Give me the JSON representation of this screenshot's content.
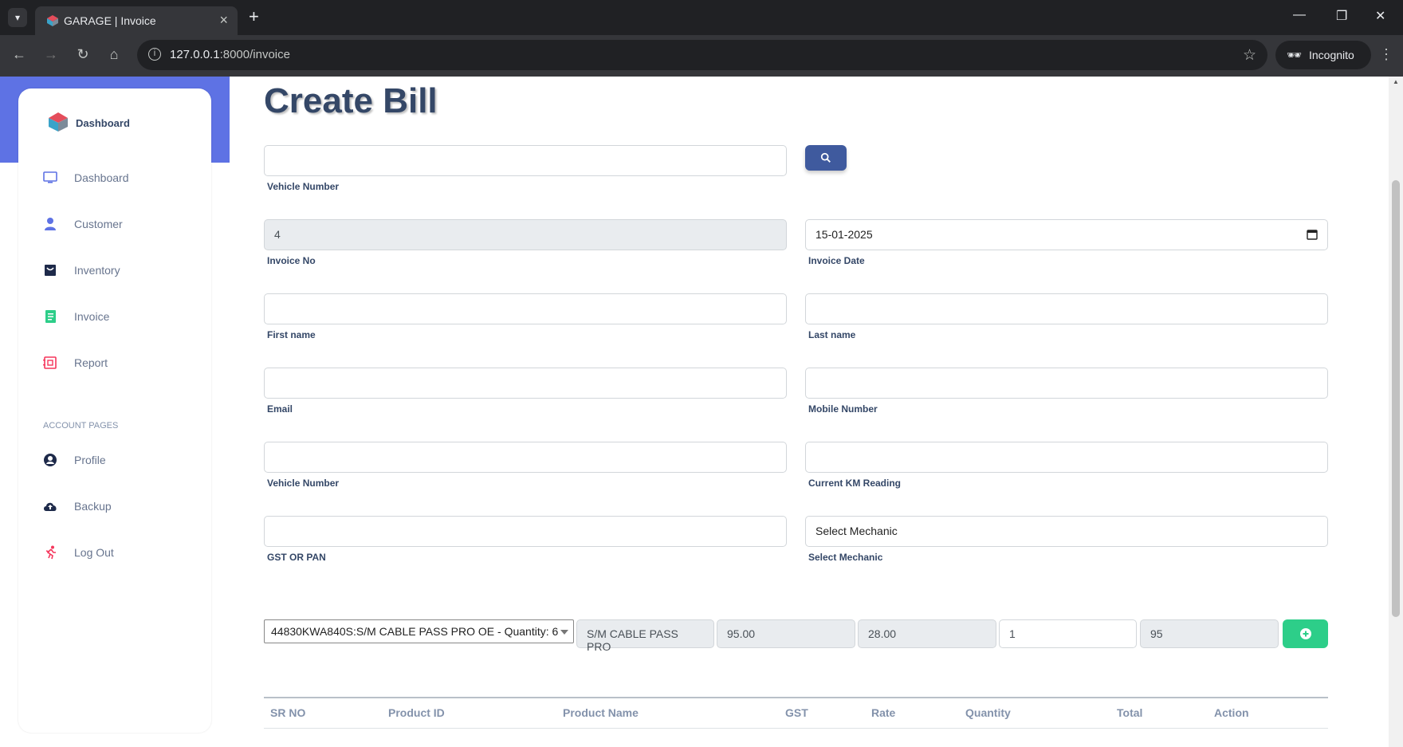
{
  "browser": {
    "tab_title": "GARAGE | Invoice",
    "url_host": "127.0.0.1",
    "url_rest": ":8000/invoice",
    "profile_label": "Incognito"
  },
  "sidebar": {
    "brand": "Dashboard",
    "items": [
      {
        "label": "Dashboard",
        "icon": "monitor-icon"
      },
      {
        "label": "Customer",
        "icon": "user-icon"
      },
      {
        "label": "Inventory",
        "icon": "box-icon"
      },
      {
        "label": "Invoice",
        "icon": "document-icon"
      },
      {
        "label": "Report",
        "icon": "report-icon"
      }
    ],
    "section_title": "ACCOUNT PAGES",
    "account_items": [
      {
        "label": "Profile",
        "icon": "profile-icon"
      },
      {
        "label": "Backup",
        "icon": "cloud-upload-icon"
      },
      {
        "label": "Log Out",
        "icon": "running-icon"
      }
    ]
  },
  "page": {
    "title": "Create Bill"
  },
  "form": {
    "vehicle_search_label": "Vehicle Number",
    "invoice_no": {
      "label": "Invoice No",
      "value": "4"
    },
    "invoice_date": {
      "label": "Invoice Date",
      "value": "15-01-2025"
    },
    "first_name_label": "First name",
    "last_name_label": "Last name",
    "email_label": "Email",
    "mobile_label": "Mobile Number",
    "vehicle_label": "Vehicle Number",
    "km_label": "Current KM Reading",
    "gst_label": "GST OR PAN",
    "mechanic": {
      "label": "Select Mechanic",
      "value": "Select Mechanic"
    }
  },
  "line_item": {
    "product_select": "44830KWA840S:S/M CABLE PASS PRO OE - Quantity: 6",
    "product_name": "S/M CABLE PASS PRO",
    "rate": "95.00",
    "gst": "28.00",
    "quantity": "1",
    "total": "95"
  },
  "table": {
    "headers": [
      "SR NO",
      "Product ID",
      "Product Name",
      "GST",
      "Rate",
      "Quantity",
      "Total",
      "Action"
    ]
  },
  "colors": {
    "primary": "#5e72e4",
    "search_button": "#3f5a9e",
    "add_button": "#2dce89",
    "heading": "#344767"
  }
}
